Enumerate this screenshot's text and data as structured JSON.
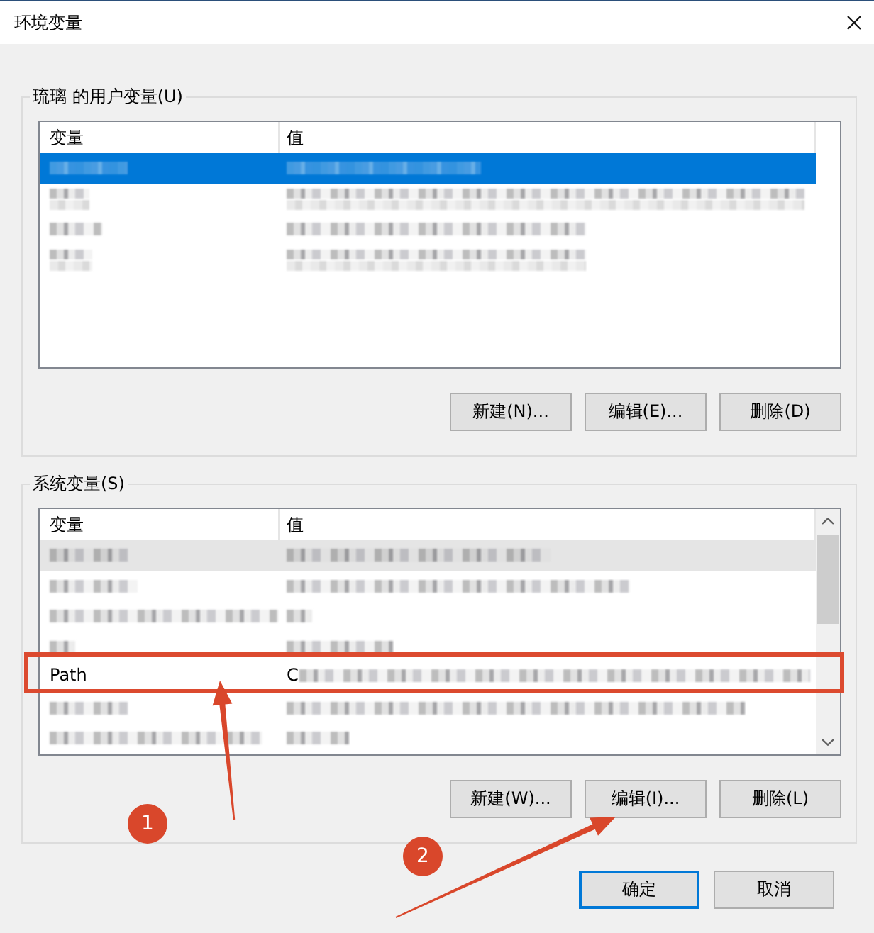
{
  "window": {
    "title": "环境变量"
  },
  "user_variables": {
    "label": "琉璃 的用户变量(U)",
    "list": {
      "focused": true,
      "scrollbar": false,
      "columns": [
        "变量",
        "值"
      ],
      "rows": [
        {
          "selected": true,
          "highlighted": false,
          "cells": [
            {
              "kind": "blurred"
            },
            {
              "kind": "blurred"
            }
          ]
        },
        {
          "selected": false,
          "highlighted": false,
          "cells": [
            {
              "kind": "blurred"
            },
            {
              "kind": "blurred"
            }
          ]
        },
        {
          "selected": false,
          "highlighted": false,
          "cells": [
            {
              "kind": "blurred"
            },
            {
              "kind": "blurred"
            }
          ]
        },
        {
          "selected": false,
          "highlighted": false,
          "cells": [
            {
              "kind": "blurred"
            },
            {
              "kind": "blurred"
            }
          ]
        }
      ]
    },
    "buttons": [
      {
        "label": "新建(N)..."
      },
      {
        "label": "编辑(E)..."
      },
      {
        "label": "删除(D)"
      }
    ]
  },
  "system_variables": {
    "label": "系统变量(S)",
    "list": {
      "focused": false,
      "scrollbar": true,
      "columns": [
        "变量",
        "值"
      ],
      "rows": [
        {
          "selected": true,
          "highlighted": false,
          "cells": [
            {
              "kind": "blurred"
            },
            {
              "kind": "blurred"
            }
          ]
        },
        {
          "selected": false,
          "highlighted": false,
          "cells": [
            {
              "kind": "blurred"
            },
            {
              "kind": "blurred"
            }
          ]
        },
        {
          "selected": false,
          "highlighted": false,
          "cells": [
            {
              "kind": "blurred"
            },
            {
              "kind": "blurred"
            }
          ]
        },
        {
          "selected": false,
          "highlighted": false,
          "cells": [
            {
              "kind": "blurred"
            },
            {
              "kind": "blurred"
            }
          ]
        },
        {
          "selected": false,
          "highlighted": true,
          "cells": [
            {
              "kind": "text",
              "text": "Path"
            },
            {
              "kind": "partly_blurred",
              "text": "C"
            }
          ]
        },
        {
          "selected": false,
          "highlighted": false,
          "cells": [
            {
              "kind": "blurred"
            },
            {
              "kind": "blurred"
            }
          ]
        },
        {
          "selected": false,
          "highlighted": false,
          "cells": [
            {
              "kind": "blurred"
            },
            {
              "kind": "blurred"
            }
          ]
        }
      ]
    },
    "buttons": [
      {
        "label": "新建(W)..."
      },
      {
        "label": "编辑(I)..."
      },
      {
        "label": "删除(L)"
      }
    ]
  },
  "dialog_buttons": [
    {
      "label": "确定",
      "default": true
    },
    {
      "label": "取消",
      "default": false
    }
  ],
  "annotations": [
    {
      "kind": "step",
      "label": "1"
    },
    {
      "kind": "step",
      "label": "2"
    }
  ]
}
